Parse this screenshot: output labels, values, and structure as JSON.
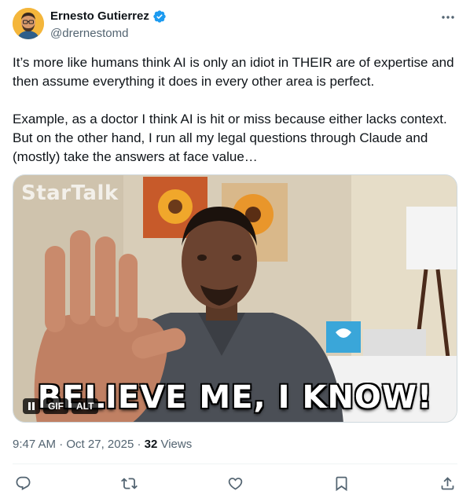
{
  "author": {
    "name": "Ernesto Gutierrez",
    "handle": "@drernestomd",
    "verified_color": "#1d9bf0"
  },
  "tweet": {
    "text": "It’s more like humans think AI is only an idiot in THEIR are of expertise and then assume everything it does in every other area is perfect.\n\nExample, as a doctor I think AI is hit or miss because either lacks context. But on the other hand, I run all my legal questions through Claude and (mostly) take the answers at face value…"
  },
  "media": {
    "watermark": "StarTalk",
    "caption": "BELIEVE ME, I KNOW!",
    "gif_label": "GIF",
    "alt_label": "ALT"
  },
  "meta": {
    "time": "9:47 AM",
    "separator1": " · ",
    "date": "Oct 27, 2025",
    "separator2": " · ",
    "views_count": "32",
    "views_label": " Views"
  },
  "icons": {
    "more": "more-dots-icon",
    "reply": "reply-icon",
    "retweet": "retweet-icon",
    "like": "heart-icon",
    "bookmark": "bookmark-icon",
    "share": "share-icon",
    "verified": "verified-badge-icon"
  },
  "colors": {
    "text": "#0f1419",
    "secondary": "#536471",
    "accent": "#1d9bf0"
  }
}
